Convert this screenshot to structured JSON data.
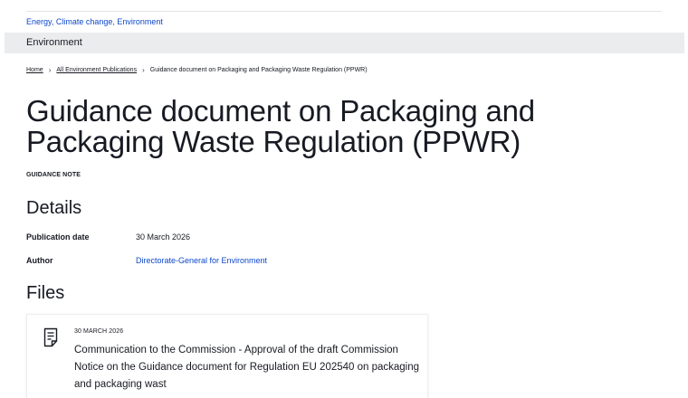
{
  "header": {
    "topics": "Energy, Climate change, Environment",
    "site_name": "Environment"
  },
  "breadcrumb": [
    {
      "label": "Home"
    },
    {
      "label": "All Environment Publications"
    },
    {
      "label": "Guidance document on Packaging and Packaging Waste Regulation (PPWR)"
    }
  ],
  "page": {
    "title": "Guidance document on Packaging and Packaging Waste Regulation (PPWR)",
    "doc_type": "GUIDANCE NOTE"
  },
  "details": {
    "heading": "Details",
    "publication_date_label": "Publication date",
    "publication_date_value": "30 March 2026",
    "author_label": "Author",
    "author_value": "Directorate-General for Environment"
  },
  "files": {
    "heading": "Files",
    "items": [
      {
        "date": "30 MARCH 2026",
        "title": "Communication to the Commission - Approval of the draft Commission Notice on the Guidance document for Regulation EU 202540 on packaging and packaging wast",
        "icon": "document-icon"
      }
    ]
  },
  "colors": {
    "link": "#0e47cb",
    "text": "#171a22",
    "site_bar_bg": "#ebecee"
  }
}
